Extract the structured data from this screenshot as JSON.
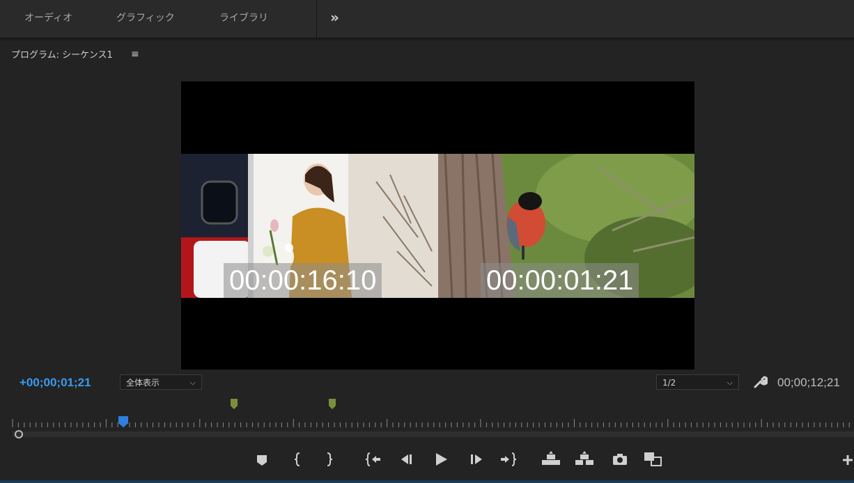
{
  "tabs": [
    "オーディオ",
    "グラフィック",
    "ライブラリ"
  ],
  "panel": {
    "title": "プログラム: シーケンス1"
  },
  "preview": {
    "left_timecode": "00:00:16:10",
    "right_timecode": "00:00:01:21"
  },
  "controls": {
    "current_timecode": "+00;00;01;21",
    "zoom_select": "全体表示",
    "resolution_select": "1/2",
    "duration_timecode": "00;00;12;21"
  },
  "transport": {
    "buttons": [
      "add-marker",
      "mark-in",
      "mark-out",
      "go-to-in",
      "step-back",
      "play",
      "step-forward",
      "go-to-out",
      "lift",
      "extract",
      "export-frame",
      "comparison-view",
      "button-editor"
    ]
  },
  "colors": {
    "playhead": "#2f7fe0",
    "timecode_blue": "#3a9bf0",
    "marker_green": "#7a8f3a"
  }
}
